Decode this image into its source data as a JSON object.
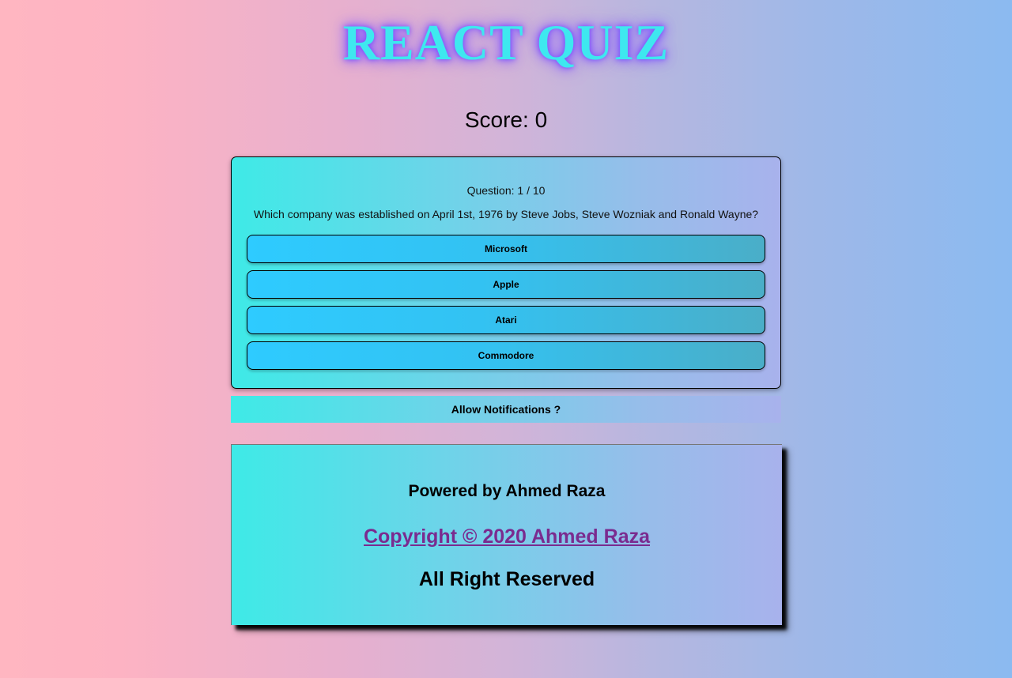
{
  "app": {
    "title": "REACT QUIZ"
  },
  "score": {
    "label": "Score: 0",
    "value": 0
  },
  "quiz": {
    "question_number": "Question: 1 / 10",
    "current": 1,
    "total": 10,
    "question": "Which company was established on April 1st, 1976 by Steve Jobs, Steve Wozniak and Ronald Wayne?",
    "answers": [
      "Microsoft",
      "Apple",
      "Atari",
      "Commodore"
    ]
  },
  "notifications": {
    "label": "Allow Notifications ?"
  },
  "footer": {
    "powered_by": "Powered by Ahmed Raza",
    "copyright": "Copyright © 2020 Ahmed Raza",
    "rights": "All Right Reserved"
  },
  "colors": {
    "title": "#3ee8ef",
    "title_glow": "#7a4dff",
    "answer_button": "#2ecbff",
    "card_start": "#3eeae7",
    "card_end": "#a8b2ec",
    "link": "#7a2b8f"
  }
}
